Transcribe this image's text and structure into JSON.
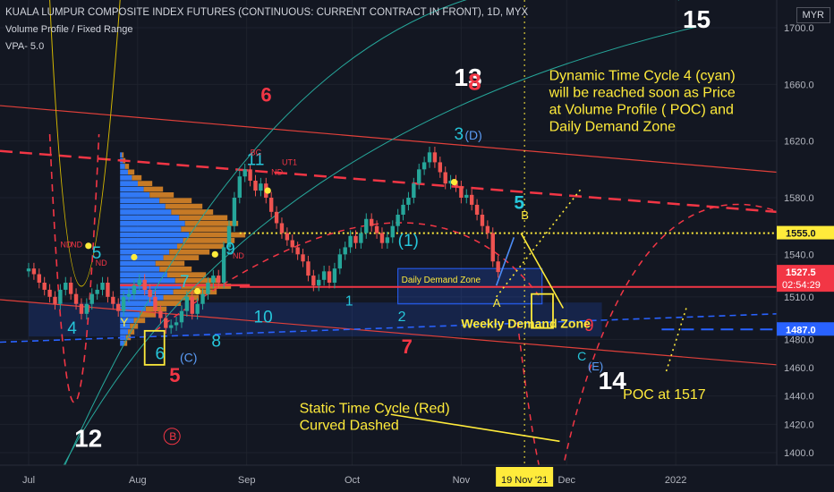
{
  "header": {
    "title": "KUALA LUMPUR COMPOSITE INDEX FUTURES (CONTINUOUS: CURRENT CONTRACT IN FRONT), 1D, MYX",
    "indicator1": "Volume Profile / Fixed Range",
    "indicator2": "VPA- 5.0",
    "currency": "MYR"
  },
  "chart_data": {
    "type": "candlestick",
    "ylim": [
      1392,
      1710
    ],
    "y_ticks": [
      1400,
      1420,
      1440,
      1460,
      1480,
      1510,
      1540,
      1580,
      1620,
      1660,
      1700
    ],
    "y_tick_labels": [
      "1400.0",
      "1420.0",
      "1440.0",
      "1460.0",
      "1480.0",
      "1510.0",
      "1540.0",
      "1580.0",
      "1620.0",
      "1660.0",
      "1700.0"
    ],
    "x_labels": [
      "Jul",
      "Aug",
      "Sep",
      "Oct",
      "Nov",
      "Dec",
      "2022"
    ],
    "x_label_days": [
      0,
      31,
      62,
      92,
      123,
      153,
      184
    ],
    "x_start_date": "2021-06-22",
    "date_marker": "19 Nov '21",
    "date_marker_day": 141,
    "price_labels": [
      {
        "value": 1555.0,
        "text": "1555.0",
        "color": "#ffeb3b",
        "text_color": "#131722"
      },
      {
        "value": 1527.5,
        "text": "1527.5",
        "color": "#f23645",
        "text_color": "#ffffff"
      },
      {
        "value": 1487.0,
        "text": "1487.0",
        "color": "#2962ff",
        "text_color": "#ffffff"
      }
    ],
    "countdown": "02:54:29",
    "close_values": [
      1530,
      1526,
      1520,
      1515,
      1510,
      1505,
      1515,
      1520,
      1512,
      1505,
      1498,
      1505,
      1512,
      1515,
      1520,
      1510,
      1505,
      1500,
      1510,
      1512,
      1518,
      1522,
      1515,
      1510,
      1500,
      1495,
      1488,
      1490,
      1492,
      1500,
      1510,
      1498,
      1505,
      1512,
      1520,
      1525,
      1520,
      1545,
      1560,
      1580,
      1595,
      1600,
      1592,
      1585,
      1590,
      1580,
      1570,
      1562,
      1555,
      1550,
      1545,
      1540,
      1535,
      1525,
      1518,
      1522,
      1528,
      1520,
      1530,
      1540,
      1545,
      1553,
      1548,
      1555,
      1565,
      1560,
      1555,
      1548,
      1552,
      1560,
      1568,
      1575,
      1580,
      1590,
      1600,
      1605,
      1612,
      1605,
      1598,
      1590,
      1592,
      1588,
      1580,
      1582,
      1575,
      1568,
      1560,
      1555,
      1535,
      1527.5
    ],
    "volume_profile": [
      2,
      3,
      5,
      8,
      12,
      18,
      24,
      30,
      40,
      46,
      52,
      60,
      66,
      62,
      70,
      64,
      58,
      50,
      44,
      36,
      40,
      48,
      56,
      62,
      54,
      44,
      34,
      26,
      20,
      14,
      10,
      8,
      6,
      4
    ],
    "annotations": [
      {
        "text": "13",
        "color": "#ffffff",
        "size": 28,
        "price": 1659,
        "day": 121
      },
      {
        "text": "8",
        "color": "#f23645",
        "size": 26,
        "price": 1656,
        "day": 125
      },
      {
        "text": "15",
        "color": "#ffffff",
        "size": 28,
        "price": 1700,
        "day": 186
      },
      {
        "text": "6",
        "color": "#f23645",
        "size": 22,
        "price": 1648,
        "day": 66
      },
      {
        "text": "3",
        "color": "#26c6da",
        "size": 19,
        "price": 1621,
        "day": 121
      },
      {
        "text": "(D)",
        "color": "#5b9cf6",
        "size": 14,
        "price": 1621,
        "day": 124
      },
      {
        "text": "11",
        "color": "#26c6da",
        "size": 19,
        "price": 1603,
        "day": 62
      },
      {
        "text": "5",
        "color": "#26c6da",
        "size": 21,
        "price": 1572,
        "day": 138
      },
      {
        "text": "B",
        "color": "#ffeb3b",
        "size": 13,
        "price": 1565,
        "day": 140
      },
      {
        "text": "(1)",
        "color": "#26c6da",
        "size": 19,
        "price": 1546,
        "day": 105
      },
      {
        "text": "9",
        "color": "#26c6da",
        "size": 19,
        "price": 1540,
        "day": 56
      },
      {
        "text": "5",
        "color": "#26c6da",
        "size": 19,
        "price": 1537,
        "day": 18
      },
      {
        "text": "7",
        "color": "#26c6da",
        "size": 19,
        "price": 1517,
        "day": 43
      },
      {
        "text": "1",
        "color": "#26c6da",
        "size": 16,
        "price": 1504,
        "day": 90
      },
      {
        "text": "2",
        "color": "#26c6da",
        "size": 16,
        "price": 1493,
        "day": 105
      },
      {
        "text": "A",
        "color": "#ffeb3b",
        "size": 13,
        "price": 1503,
        "day": 132
      },
      {
        "text": "10",
        "color": "#26c6da",
        "size": 19,
        "price": 1492,
        "day": 64
      },
      {
        "text": "Y",
        "color": "#ffeb3b",
        "size": 14,
        "price": 1489,
        "day": 26
      },
      {
        "text": "4",
        "color": "#26c6da",
        "size": 19,
        "price": 1484,
        "day": 11
      },
      {
        "text": "8",
        "color": "#26c6da",
        "size": 19,
        "price": 1475,
        "day": 52
      },
      {
        "text": "7",
        "color": "#f23645",
        "size": 22,
        "price": 1470,
        "day": 106
      },
      {
        "text": "6",
        "color": "#26c6da",
        "size": 19,
        "price": 1466,
        "day": 36
      },
      {
        "text": "(C)",
        "color": "#5b9cf6",
        "size": 14,
        "price": 1464,
        "day": 43
      },
      {
        "text": "9",
        "color": "#f23645",
        "size": 19,
        "price": 1486,
        "day": 158
      },
      {
        "text": "C",
        "color": "#26c6da",
        "size": 14,
        "price": 1465,
        "day": 156
      },
      {
        "text": "(E)",
        "color": "#5b9cf6",
        "size": 13,
        "price": 1458,
        "day": 159
      },
      {
        "text": "5",
        "color": "#f23645",
        "size": 22,
        "price": 1450,
        "day": 40
      },
      {
        "text": "14",
        "color": "#ffffff",
        "size": 28,
        "price": 1445,
        "day": 162
      },
      {
        "text": "12",
        "color": "#ffffff",
        "size": 28,
        "price": 1404,
        "day": 13
      },
      {
        "text": "B",
        "color": "#f23645",
        "size": 12,
        "price": 1409,
        "day": 40
      },
      {
        "text": "BC",
        "color": "#f23645",
        "size": 9,
        "price": 1610,
        "day": 63
      },
      {
        "text": "UT1",
        "color": "#f23645",
        "size": 9,
        "price": 1603,
        "day": 72
      },
      {
        "text": "ND",
        "color": "#f23645",
        "size": 9,
        "price": 1596,
        "day": 69
      },
      {
        "text": "ND",
        "color": "#f23645",
        "size": 9,
        "price": 1545,
        "day": 9
      },
      {
        "text": "ND",
        "color": "#f23645",
        "size": 9,
        "price": 1545,
        "day": 12
      },
      {
        "text": "ND",
        "color": "#f23645",
        "size": 9,
        "price": 1532,
        "day": 19
      },
      {
        "text": "ND",
        "color": "#f23645",
        "size": 9,
        "price": 1537,
        "day": 58
      }
    ],
    "zones": [
      {
        "label": "Daily Demand Zone",
        "price_top": 1530,
        "price_bottom": 1505,
        "start_day": 105,
        "end_day": 146
      },
      {
        "label": "Weekly Demand Zone",
        "price_top": 1506,
        "price_bottom": 1482,
        "start_day": 0,
        "end_day": 163
      }
    ],
    "levels": [
      {
        "value": 1555,
        "color": "#ffeb3b",
        "style": "dotted"
      },
      {
        "value": 1517,
        "color": "#f23645",
        "style": "solid"
      },
      {
        "value": 1487,
        "color": "#2962ff",
        "style": "dashed"
      }
    ],
    "notes": [
      {
        "lines": [
          "Dynamic Time Cycle 4 (cyan)",
          "will be reached soon as Price",
          "at Volume Profile ( POC) and",
          "Daily Demand Zone"
        ],
        "color": "#ffeb3b",
        "size": 16,
        "price": 1663,
        "day": 148
      },
      {
        "lines": [
          "Weekly Demand Zone"
        ],
        "color": "#ffeb3b",
        "size": 14,
        "price": 1488,
        "day": 123
      },
      {
        "lines": [
          "Static Time Cycle (Red)",
          "Curved Dashed"
        ],
        "color": "#ffeb3b",
        "size": 16,
        "price": 1428,
        "day": 77
      },
      {
        "lines": [
          "POC at 1517"
        ],
        "color": "#ffeb3b",
        "size": 16,
        "price": 1438,
        "day": 169
      }
    ]
  }
}
